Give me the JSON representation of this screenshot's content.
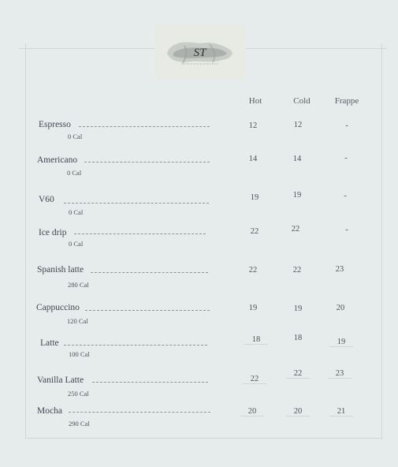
{
  "brand": {
    "logo_mark": "ST"
  },
  "columns": {
    "hot": "Hot",
    "cold": "Cold",
    "frappe": "Frappe"
  },
  "items": [
    {
      "name": "Espresso",
      "cal": "0 Cal",
      "hot": "12",
      "cold": "12",
      "frappe": "-"
    },
    {
      "name": "Americano",
      "cal": "0 Cal",
      "hot": "14",
      "cold": "14",
      "frappe": "-"
    },
    {
      "name": "V60",
      "cal": "0 Cal",
      "hot": "19",
      "cold": "19",
      "frappe": "-"
    },
    {
      "name": "Ice drip",
      "cal": "0 Cal",
      "hot": "22",
      "cold": "22",
      "frappe": "-"
    },
    {
      "name": "Spanish latte",
      "cal": "280 Cal",
      "hot": "22",
      "cold": "22",
      "frappe": "23"
    },
    {
      "name": "Cappuccino",
      "cal": "120 Cal",
      "hot": "19",
      "cold": "19",
      "frappe": "20"
    },
    {
      "name": "Latte",
      "cal": "100 Cal",
      "hot": "18",
      "cold": "18",
      "frappe": "19"
    },
    {
      "name": "Vanilla Latte",
      "cal": "250 Cal",
      "hot": "22",
      "cold": "22",
      "frappe": "23"
    },
    {
      "name": "Mocha",
      "cal": "290 Cal",
      "hot": "20",
      "cold": "20",
      "frappe": "21"
    }
  ]
}
